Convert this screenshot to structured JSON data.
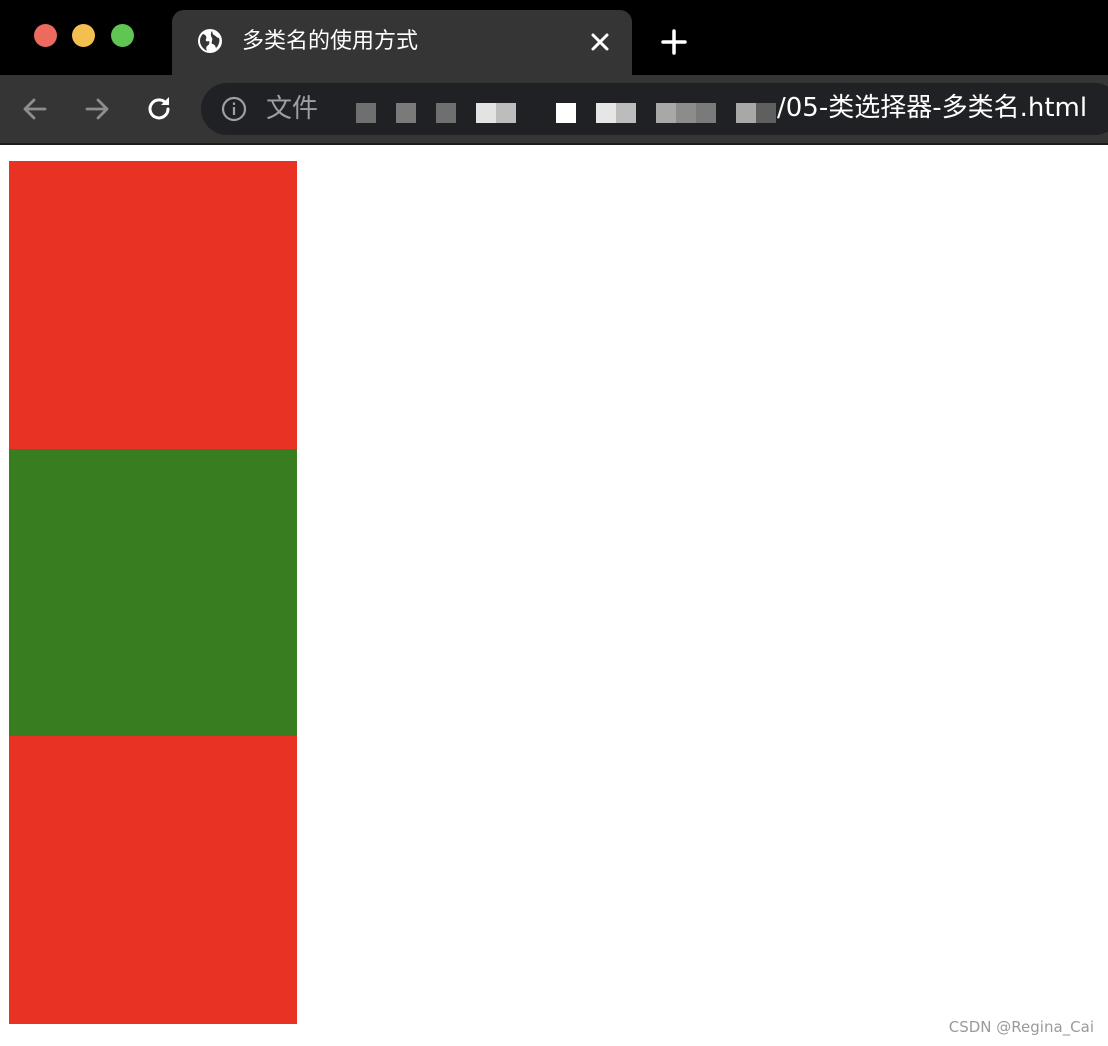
{
  "window": {
    "tab_title": "多类名的使用方式"
  },
  "toolbar": {
    "scheme_label": "文件",
    "url_visible_text": "/05-类选择器-多类名.html"
  },
  "page": {
    "boxes": [
      {
        "color": "#e83223"
      },
      {
        "color": "#387e21"
      },
      {
        "color": "#e83223"
      }
    ]
  },
  "watermark": "CSDN @Regina_Cai",
  "icons": {
    "tab_favicon": "globe-icon",
    "tab_close": "close-icon",
    "new_tab": "plus-icon",
    "back": "arrow-left-icon",
    "forward": "arrow-right-icon",
    "reload": "reload-icon",
    "site_info": "info-icon"
  },
  "colors": {
    "titlebar_bg": "#000000",
    "toolbar_bg": "#353535",
    "omnibox_bg": "#202124",
    "traffic_close": "#ec6a5e",
    "traffic_minimize": "#f4bf4f",
    "traffic_maximize": "#61c554"
  }
}
